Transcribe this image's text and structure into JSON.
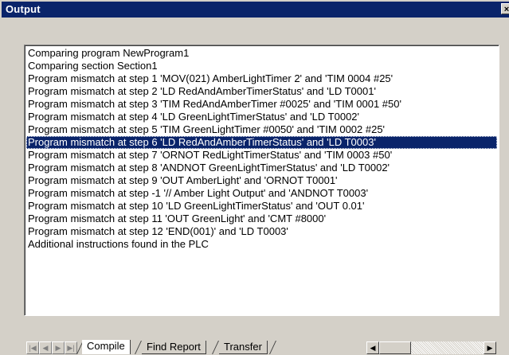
{
  "window": {
    "title": "Output",
    "close_label": "×"
  },
  "output": {
    "lines": [
      "Comparing program NewProgram1",
      "Comparing section Section1",
      "Program mismatch at step 1 'MOV(021) AmberLightTimer 2' and 'TIM 0004 #25'",
      "Program mismatch at step 2 'LD RedAndAmberTimerStatus' and 'LD T0001'",
      "Program mismatch at step 3 'TIM RedAndAmberTimer #0025' and 'TIM 0001 #50'",
      "Program mismatch at step 4 'LD GreenLightTimerStatus' and 'LD T0002'",
      "Program mismatch at step 5 'TIM GreenLightTimer #0050' and 'TIM 0002 #25'",
      "Program mismatch at step 6 'LD RedAndAmberTimerStatus' and 'LD T0003'",
      "Program mismatch at step 7 'ORNOT RedLightTimerStatus' and 'TIM 0003 #50'",
      "Program mismatch at step 8 'ANDNOT GreenLightTimerStatus' and 'LD T0002'",
      "Program mismatch at step 9 'OUT AmberLight' and 'ORNOT T0001'",
      "Program mismatch at step -1 '// Amber Light Output' and 'ANDNOT T0003'",
      "Program mismatch at step 10 'LD GreenLightTimerStatus' and 'OUT 0.01'",
      "Program mismatch at step 11 'OUT GreenLight' and 'CMT #8000'",
      "Program mismatch at step 12 'END(001)' and 'LD T0003'",
      "Additional instructions found in the PLC"
    ],
    "selected_index": 7
  },
  "tabs": [
    {
      "label": "Compile",
      "active": true
    },
    {
      "label": "Find Report",
      "active": false
    },
    {
      "label": "Transfer",
      "active": false
    }
  ],
  "colors": {
    "selection": "#0a246a",
    "titlebar": "#0a246a",
    "face": "#d4d0c8"
  },
  "icons": {
    "tab_nav": [
      "first-icon",
      "prev-icon",
      "next-icon",
      "last-icon"
    ],
    "scroll": [
      "scroll-left-icon",
      "scroll-right-icon"
    ]
  }
}
